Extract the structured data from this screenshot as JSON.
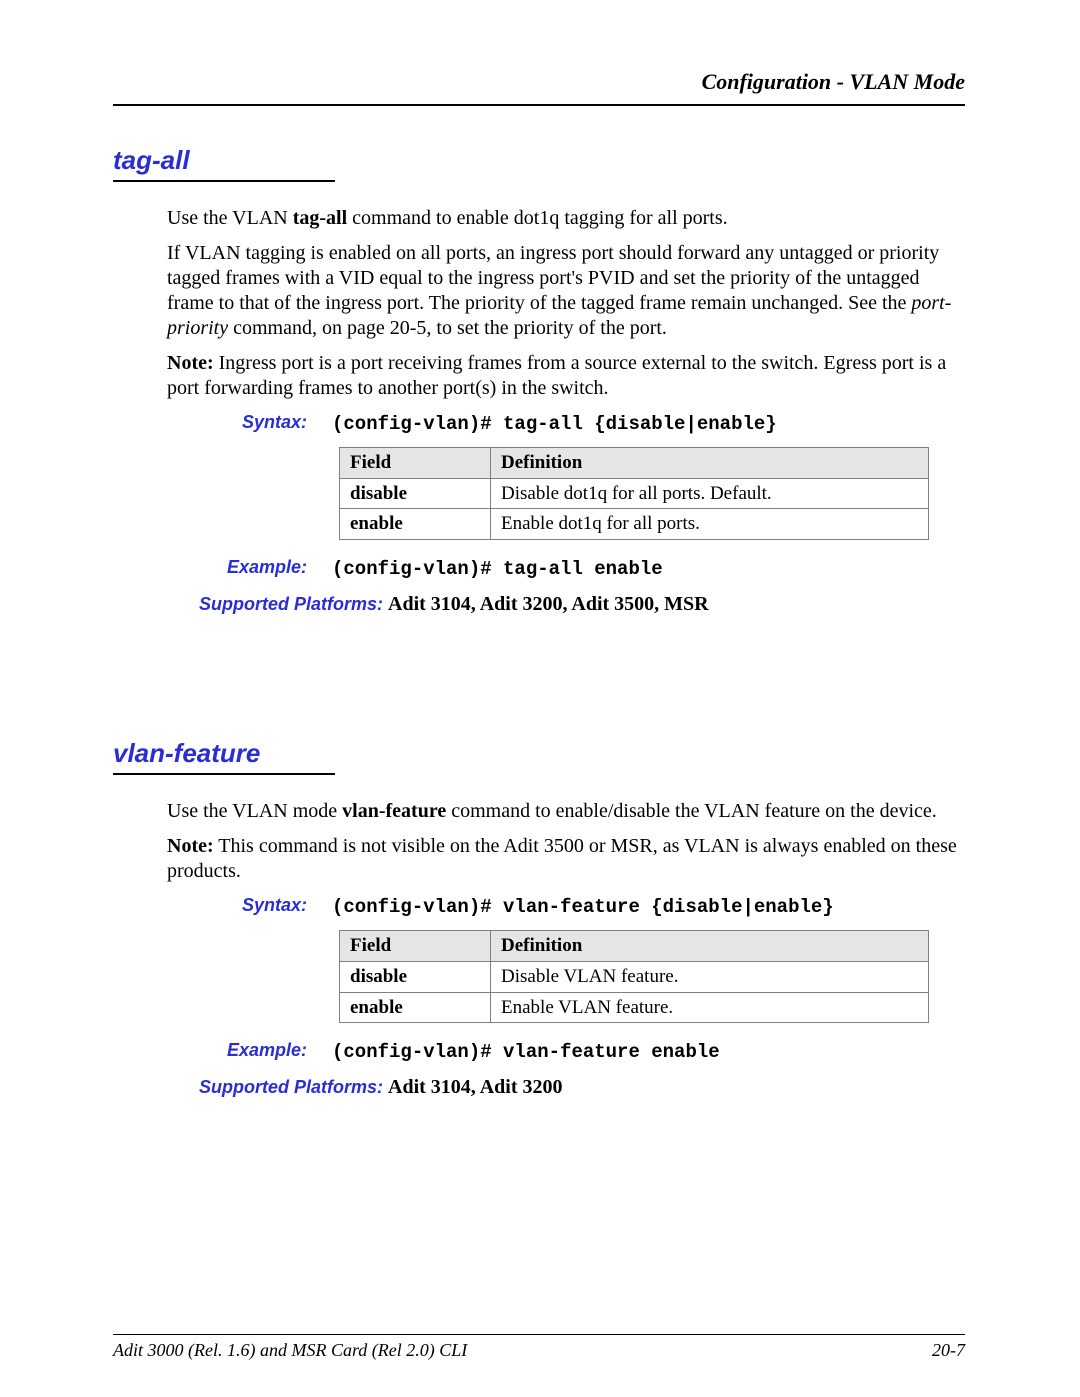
{
  "header": {
    "title": "Configuration - VLAN Mode"
  },
  "sections": [
    {
      "heading": "tag-all",
      "paragraphs": {
        "p1a": "Use the VLAN ",
        "p1b": "tag-all",
        "p1c": " command to enable dot1q tagging for all ports.",
        "p2a": "If VLAN tagging is enabled on all ports, an ingress port should forward any untagged or priority tagged frames with a VID equal to the ingress port's PVID and set the priority of the untagged frame to that of the ingress port. The priority of the tagged frame remain unchanged. See the ",
        "p2b": "port-priority",
        "p2c": " command, on page 20-5, to set the priority of the port.",
        "note_label": "Note:",
        "note_text": " Ingress port is a port receiving frames from a source external to the switch. Egress port is a port forwarding frames to another port(s) in the switch."
      },
      "syntax_label": "Syntax:",
      "syntax_cmd": "(config-vlan)# tag-all {disable|enable}",
      "table": {
        "h1": "Field",
        "h2": "Definition",
        "rows": [
          {
            "f": "disable",
            "d": "Disable dot1q for all ports. Default."
          },
          {
            "f": "enable",
            "d": "Enable dot1q for all ports."
          }
        ]
      },
      "example_label": "Example:",
      "example_cmd": "(config-vlan)# tag-all enable",
      "platforms_label": "Supported Platforms: ",
      "platforms_value": " Adit 3104, Adit 3200, Adit 3500, MSR"
    },
    {
      "heading": "vlan-feature",
      "paragraphs": {
        "p1a": "Use the VLAN mode ",
        "p1b": "vlan-feature",
        "p1c": " command to enable/disable the VLAN feature on the device.",
        "note_label": "Note:",
        "note_text": " This command is not visible on the Adit 3500 or MSR, as VLAN is always enabled on these products."
      },
      "syntax_label": "Syntax:",
      "syntax_cmd": "(config-vlan)# vlan-feature {disable|enable}",
      "table": {
        "h1": "Field",
        "h2": "Definition",
        "rows": [
          {
            "f": "disable",
            "d": "Disable VLAN feature."
          },
          {
            "f": "enable",
            "d": "Enable VLAN feature."
          }
        ]
      },
      "example_label": "Example:",
      "example_cmd": "(config-vlan)# vlan-feature enable",
      "platforms_label": "Supported Platforms: ",
      "platforms_value": " Adit 3104, Adit 3200"
    }
  ],
  "footer": {
    "left": "Adit 3000 (Rel. 1.6) and MSR Card (Rel 2.0) CLI",
    "right": "20-7"
  }
}
